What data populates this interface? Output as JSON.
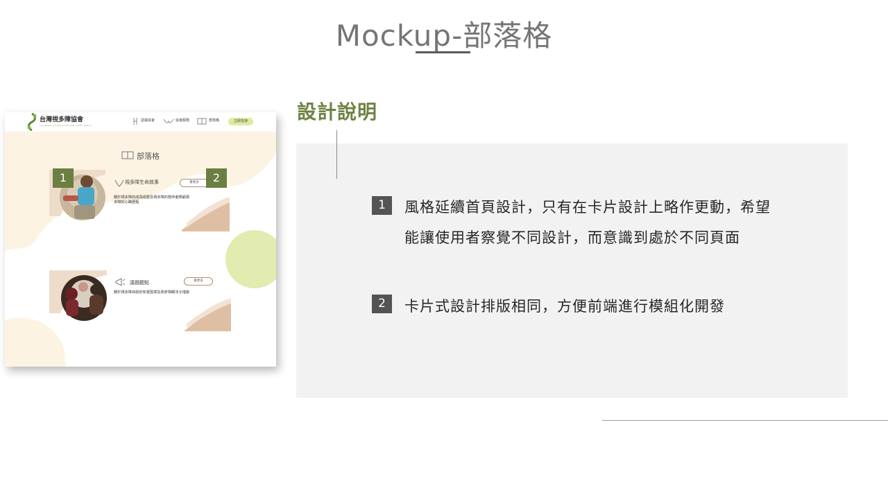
{
  "slide": {
    "title": "Mockup-部落格",
    "section_title": "設計說明"
  },
  "points": [
    {
      "number": "1",
      "line1": "風格延續首頁設計，只有在卡片設計上略作更動，希望",
      "line2": "能讓使用者察覺不同設計，而意識到處於不同頁面"
    },
    {
      "number": "2",
      "line1": "卡片式設計排版相同，方便前端進行模組化開發"
    }
  ],
  "mockup": {
    "logo_text": "台灣視多障協會",
    "logo_sub": "TAIWAN ASSOCIATION FOR MDVI",
    "nav": [
      "認識協會",
      "協會服務",
      "部落格"
    ],
    "cta": "立即支持",
    "page_heading": "部落格",
    "cards": [
      {
        "title": "視多障生命故事",
        "button": "看更多",
        "desc_line1": "關於視多障的成長經歷及視多障的陪伴者照顧視",
        "desc_line2": "多障的心路歷程"
      },
      {
        "title": "議題觀點",
        "button": "看更多",
        "desc_line1": "關於視多障目前的安置困境及政府相關法令措施"
      }
    ],
    "badges": [
      "1",
      "2"
    ]
  },
  "colors": {
    "accent_green": "#6d8242",
    "badge_green": "#6a7f41",
    "num_box_gray": "#545454",
    "cream_bg": "#fdf3e3",
    "card_tan": "#dfbfa4",
    "lime_circle": "#e2ebb0"
  }
}
